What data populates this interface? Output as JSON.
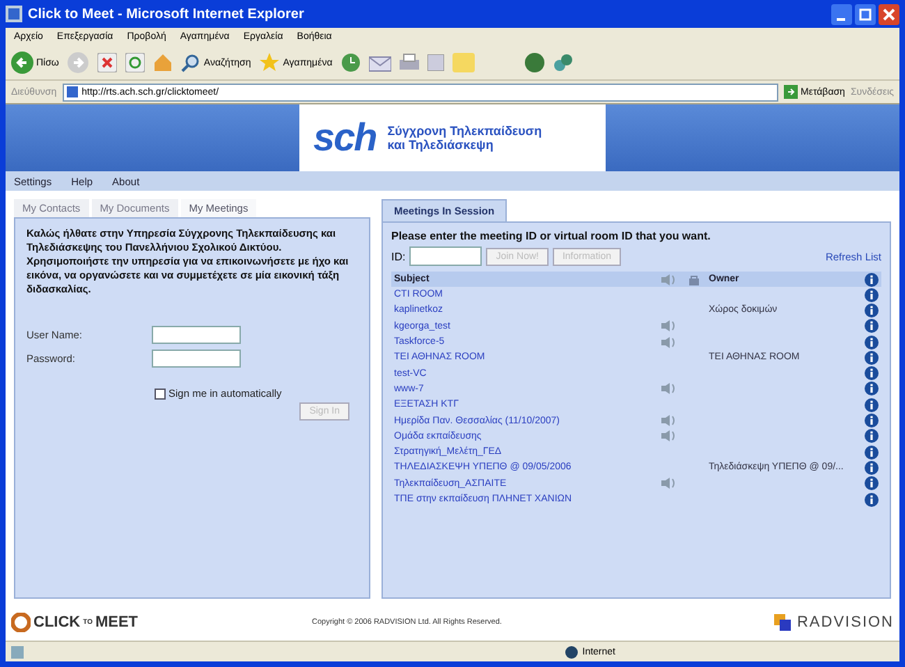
{
  "window": {
    "title": "Click to Meet - Microsoft Internet Explorer"
  },
  "menu": [
    "Αρχείο",
    "Επεξεργασία",
    "Προβολή",
    "Αγαπημένα",
    "Εργαλεία",
    "Βοήθεια"
  ],
  "toolbar": {
    "back": "Πίσω",
    "search": "Αναζήτηση",
    "favorites": "Αγαπημένα"
  },
  "address_bar": {
    "label": "Διεύθυνση",
    "value": "http://rts.ach.sch.gr/clicktomeet/",
    "go": "Μετάβαση",
    "links": "Συνδέσεις"
  },
  "banner": {
    "logo": "sch",
    "tagline": [
      "Σύγχρονη Τηλεκπαίδευση",
      "και Τηλεδιάσκεψη"
    ]
  },
  "nav": [
    "Settings",
    "Help",
    "About"
  ],
  "left_panel": {
    "tabs": [
      {
        "label": "My Contacts",
        "selected": false
      },
      {
        "label": "My Documents",
        "selected": false
      },
      {
        "label": "My Meetings",
        "selected": true
      }
    ],
    "welcome": "Καλώς ήλθατε στην Υπηρεσία Σύγχρονης Τηλεκπαίδευσης και Τηλεδιάσκεψης του Πανελλήνιου Σχολικού Δικτύου. Χρησιμοποιήστε την υπηρεσία για να επικοινωνήσετε με ήχο και εικόνα, να οργανώσετε και να συμμετέχετε σε μία εικονική τάξη διδασκαλίας.",
    "user_name_label": "User Name:",
    "password_label": "Password:",
    "remember": {
      "label": "Sign me in automatically",
      "checked": false
    },
    "sign_in": {
      "label": "Sign In",
      "disabled": true
    }
  },
  "right_panel": {
    "tab": "Meetings In Session",
    "prompt": "Please enter the meeting ID or virtual room ID that you want.",
    "id_label": "ID:",
    "buttons": [
      {
        "label": "Join Now!",
        "disabled": true
      },
      {
        "label": "Information",
        "disabled": true
      }
    ],
    "refresh": "Refresh List",
    "columns": [
      "Subject",
      "Owner"
    ],
    "rows": [
      {
        "subject": "CTI ROOM",
        "audio": false,
        "owner": ""
      },
      {
        "subject": "kaplinetkoz",
        "audio": false,
        "owner": "Χώρος δοκιμών"
      },
      {
        "subject": "kgeorga_test",
        "audio": true,
        "owner": ""
      },
      {
        "subject": "Taskforce-5",
        "audio": true,
        "owner": ""
      },
      {
        "subject": "ΤΕΙ ΑΘΗΝΑΣ ROOM",
        "audio": false,
        "owner": "ΤΕΙ ΑΘΗΝΑΣ ROOM"
      },
      {
        "subject": "test-VC",
        "audio": false,
        "owner": ""
      },
      {
        "subject": "www-7",
        "audio": true,
        "owner": ""
      },
      {
        "subject": "ΕΞΕΤΑΣΗ ΚΤΓ",
        "audio": false,
        "owner": ""
      },
      {
        "subject": "Ημερίδα Παν. Θεσσαλίας (11/10/2007)",
        "audio": true,
        "owner": ""
      },
      {
        "subject": "Ομάδα εκπαίδευσης",
        "audio": true,
        "owner": ""
      },
      {
        "subject": "Στρατηγική_Μελέτη_ΓΕΔ",
        "audio": false,
        "owner": ""
      },
      {
        "subject": "ΤΗΛΕΔΙΑΣΚΕΨΗ ΥΠΕΠΘ @ 09/05/2006",
        "audio": false,
        "owner": "Τηλεδιάσκεψη ΥΠΕΠΘ @ 09/..."
      },
      {
        "subject": "Τηλεκπαίδευση_ΑΣΠΑΙΤΕ",
        "audio": true,
        "owner": ""
      },
      {
        "subject": "ΤΠΕ στην εκπαίδευση ΠΛΗΝΕΤ ΧΑΝΙΩΝ",
        "audio": false,
        "owner": ""
      }
    ]
  },
  "footer": {
    "left_logo": [
      "CLICK",
      "TO",
      "MEET"
    ],
    "copyright": "Copyright © 2006 RADVISION Ltd. All Rights Reserved.",
    "right_logo": "RADVISION"
  },
  "status_bar": {
    "zone": "Internet"
  }
}
